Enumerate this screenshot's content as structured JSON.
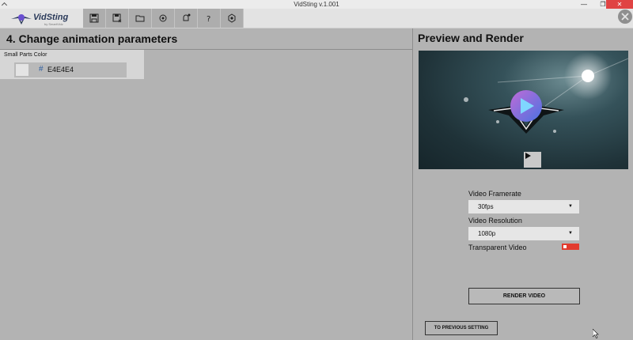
{
  "window": {
    "title": "VidSting v.1.001"
  },
  "toolbar": {
    "logo_text": "VidSting",
    "logo_sub": "by SmartVidz",
    "tools": [
      {
        "icon": "save-icon"
      },
      {
        "icon": "save-as-icon"
      },
      {
        "icon": "folder-icon"
      },
      {
        "icon": "settings-icon"
      },
      {
        "icon": "notification-icon"
      },
      {
        "icon": "help-icon"
      },
      {
        "icon": "gear-icon"
      }
    ]
  },
  "left": {
    "title": "4. Change animation parameters",
    "param": {
      "label": "Small Parts Color",
      "hash": "#",
      "value": "E4E4E4",
      "swatch_color": "#E4E4E4"
    }
  },
  "right": {
    "title": "Preview and Render",
    "framerate": {
      "label": "Video Framerate",
      "value": "30fps"
    },
    "resolution": {
      "label": "Video Resolution",
      "value": "1080p"
    },
    "transparent": {
      "label": "Transparent Video",
      "on": false,
      "color": "#e23b2e"
    },
    "render_label": "RENDER VIDEO",
    "prev_label": "TO PREVIOUS SETTING"
  }
}
